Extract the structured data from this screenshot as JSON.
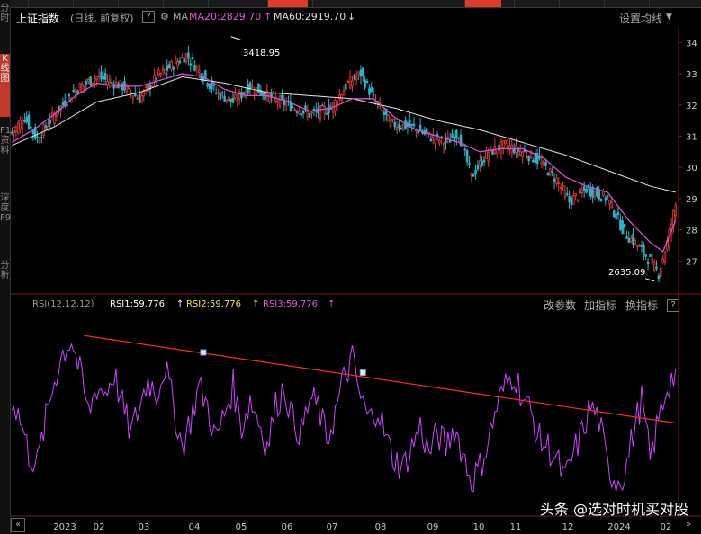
{
  "header": {
    "index_name": "上证指数",
    "mode": "(日线, 前复权)",
    "help": "?",
    "ma_label": "MA",
    "ma20": "MA20:2829.70",
    "ma60": "MA60:2919.70",
    "settings": "设置均线"
  },
  "rsi_header": {
    "label": "RSI(12,12,12)",
    "rsi1": "RSI1:59.776",
    "rsi2": "RSI2:59.776",
    "rsi3": "RSI3:59.776",
    "change_param": "改参数",
    "add_indicator": "加指标",
    "switch_indicator": "换指标",
    "help": "?"
  },
  "annotations": {
    "high": "3418.95",
    "low": "2635.09"
  },
  "left_strip": [
    "分时",
    "K线图",
    "F10资料",
    "深度F9",
    "分析"
  ],
  "watermark": "头条 @选对时机买对股",
  "colors": {
    "up": "#e8393b",
    "down": "#27b6c8",
    "ma20": "#d94fd0",
    "ma60": "#e6e6e6",
    "rsi": "#cc44ff",
    "trend": "#ff2a2a"
  },
  "chart_data": {
    "type": "candlestick",
    "title": "上证指数",
    "x_labels": [
      "2023",
      "02",
      "03",
      "04",
      "05",
      "06",
      "07",
      "08",
      "09",
      "10",
      "11",
      "12",
      "2024",
      "02"
    ],
    "y_ticks": [
      "34",
      "33",
      "32",
      "31",
      "30",
      "29",
      "28",
      "27"
    ],
    "ylim": [
      2600,
      3450
    ],
    "price_anchors": [
      [
        0,
        3110
      ],
      [
        6,
        3160
      ],
      [
        12,
        3090
      ],
      [
        20,
        3170
      ],
      [
        30,
        3250
      ],
      [
        40,
        3290
      ],
      [
        52,
        3260
      ],
      [
        60,
        3220
      ],
      [
        68,
        3290
      ],
      [
        76,
        3330
      ],
      [
        82,
        3360
      ],
      [
        88,
        3310
      ],
      [
        96,
        3240
      ],
      [
        104,
        3210
      ],
      [
        112,
        3260
      ],
      [
        120,
        3230
      ],
      [
        130,
        3200
      ],
      [
        140,
        3170
      ],
      [
        150,
        3190
      ],
      [
        158,
        3270
      ],
      [
        164,
        3300
      ],
      [
        170,
        3220
      ],
      [
        178,
        3140
      ],
      [
        188,
        3130
      ],
      [
        196,
        3100
      ],
      [
        204,
        3080
      ],
      [
        210,
        3110
      ],
      [
        216,
        2970
      ],
      [
        224,
        3050
      ],
      [
        232,
        3070
      ],
      [
        240,
        3050
      ],
      [
        248,
        3020
      ],
      [
        256,
        2960
      ],
      [
        262,
        2890
      ],
      [
        270,
        2930
      ],
      [
        280,
        2900
      ],
      [
        288,
        2790
      ],
      [
        294,
        2750
      ],
      [
        300,
        2700
      ],
      [
        304,
        2660
      ],
      [
        308,
        2760
      ],
      [
        312,
        2880
      ]
    ],
    "ma20_anchors": [
      [
        0,
        3080
      ],
      [
        10,
        3120
      ],
      [
        20,
        3170
      ],
      [
        30,
        3230
      ],
      [
        40,
        3270
      ],
      [
        50,
        3260
      ],
      [
        60,
        3260
      ],
      [
        70,
        3280
      ],
      [
        80,
        3300
      ],
      [
        90,
        3290
      ],
      [
        100,
        3250
      ],
      [
        110,
        3230
      ],
      [
        120,
        3230
      ],
      [
        130,
        3210
      ],
      [
        140,
        3180
      ],
      [
        150,
        3190
      ],
      [
        160,
        3220
      ],
      [
        170,
        3220
      ],
      [
        180,
        3160
      ],
      [
        190,
        3120
      ],
      [
        200,
        3100
      ],
      [
        210,
        3080
      ],
      [
        220,
        3050
      ],
      [
        230,
        3060
      ],
      [
        240,
        3060
      ],
      [
        250,
        3030
      ],
      [
        260,
        2970
      ],
      [
        270,
        2940
      ],
      [
        280,
        2920
      ],
      [
        290,
        2830
      ],
      [
        300,
        2760
      ],
      [
        306,
        2730
      ],
      [
        312,
        2830
      ]
    ],
    "ma60_anchors": [
      [
        0,
        3070
      ],
      [
        20,
        3130
      ],
      [
        40,
        3210
      ],
      [
        60,
        3240
      ],
      [
        80,
        3290
      ],
      [
        100,
        3270
      ],
      [
        120,
        3240
      ],
      [
        140,
        3230
      ],
      [
        160,
        3220
      ],
      [
        180,
        3190
      ],
      [
        200,
        3150
      ],
      [
        220,
        3120
      ],
      [
        240,
        3080
      ],
      [
        260,
        3040
      ],
      [
        280,
        2990
      ],
      [
        300,
        2940
      ],
      [
        312,
        2920
      ]
    ],
    "rsi": {
      "label": "RSI(12,12,12)",
      "ylim": [
        20,
        80
      ],
      "anchors": [
        [
          0,
          55
        ],
        [
          4,
          48
        ],
        [
          8,
          38
        ],
        [
          12,
          35
        ],
        [
          16,
          48
        ],
        [
          20,
          60
        ],
        [
          24,
          68
        ],
        [
          28,
          72
        ],
        [
          32,
          62
        ],
        [
          36,
          50
        ],
        [
          40,
          58
        ],
        [
          44,
          56
        ],
        [
          48,
          62
        ],
        [
          52,
          52
        ],
        [
          56,
          44
        ],
        [
          60,
          52
        ],
        [
          64,
          60
        ],
        [
          68,
          56
        ],
        [
          72,
          64
        ],
        [
          76,
          52
        ],
        [
          80,
          40
        ],
        [
          84,
          48
        ],
        [
          88,
          58
        ],
        [
          92,
          52
        ],
        [
          96,
          42
        ],
        [
          100,
          50
        ],
        [
          104,
          58
        ],
        [
          108,
          46
        ],
        [
          112,
          54
        ],
        [
          116,
          48
        ],
        [
          120,
          40
        ],
        [
          124,
          52
        ],
        [
          128,
          58
        ],
        [
          132,
          48
        ],
        [
          136,
          44
        ],
        [
          140,
          54
        ],
        [
          144,
          52
        ],
        [
          148,
          42
        ],
        [
          152,
          50
        ],
        [
          156,
          60
        ],
        [
          160,
          66
        ],
        [
          164,
          54
        ],
        [
          168,
          48
        ],
        [
          172,
          52
        ],
        [
          176,
          42
        ],
        [
          180,
          36
        ],
        [
          184,
          34
        ],
        [
          188,
          40
        ],
        [
          192,
          46
        ],
        [
          196,
          38
        ],
        [
          200,
          44
        ],
        [
          204,
          40
        ],
        [
          208,
          46
        ],
        [
          212,
          38
        ],
        [
          216,
          30
        ],
        [
          220,
          34
        ],
        [
          224,
          42
        ],
        [
          228,
          52
        ],
        [
          232,
          58
        ],
        [
          236,
          62
        ],
        [
          240,
          55
        ],
        [
          244,
          50
        ],
        [
          248,
          42
        ],
        [
          252,
          40
        ],
        [
          256,
          36
        ],
        [
          260,
          30
        ],
        [
          264,
          38
        ],
        [
          268,
          44
        ],
        [
          272,
          52
        ],
        [
          276,
          48
        ],
        [
          280,
          34
        ],
        [
          284,
          30
        ],
        [
          288,
          32
        ],
        [
          292,
          44
        ],
        [
          296,
          54
        ],
        [
          300,
          36
        ],
        [
          304,
          48
        ],
        [
          308,
          58
        ],
        [
          312,
          62
        ]
      ],
      "trendline": {
        "start_price_label": "",
        "points": [
          [
            34,
            73
          ],
          [
            312,
            47
          ]
        ]
      },
      "markers": [
        [
          90,
          68
        ],
        [
          165,
          62
        ]
      ]
    },
    "high_point": {
      "value": 3418.95,
      "index": 103
    },
    "low_point": {
      "value": 2635.09,
      "index": 302
    }
  }
}
